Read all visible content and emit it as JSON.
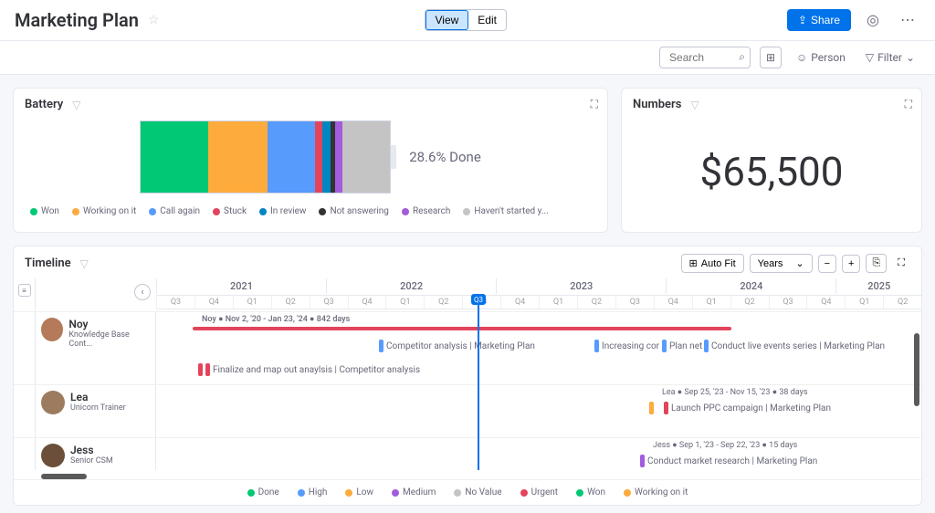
{
  "header": {
    "title": "Marketing Plan",
    "view_label": "View",
    "edit_label": "Edit",
    "share_label": "Share"
  },
  "subheader": {
    "search_placeholder": "Search",
    "person_label": "Person",
    "filter_label": "Filter"
  },
  "battery": {
    "title": "Battery",
    "pct_label": "28.6% Done",
    "legend": [
      {
        "label": "Won",
        "color": "#00c875"
      },
      {
        "label": "Working on it",
        "color": "#fdab3d"
      },
      {
        "label": "Call again",
        "color": "#579bfc"
      },
      {
        "label": "Stuck",
        "color": "#e2445c"
      },
      {
        "label": "In review",
        "color": "#0086c0"
      },
      {
        "label": "Not answering",
        "color": "#333333"
      },
      {
        "label": "Research",
        "color": "#a25ddc"
      },
      {
        "label": "Haven't started y...",
        "color": "#c4c4c4"
      }
    ]
  },
  "numbers": {
    "title": "Numbers",
    "value": "$65,500"
  },
  "timeline": {
    "title": "Timeline",
    "autofit": "Auto Fit",
    "scale": "Years",
    "years": [
      "2021",
      "2022",
      "2023",
      "2024",
      "2025"
    ],
    "quarters": [
      "Q3",
      "Q4",
      "Q1",
      "Q2",
      "Q3",
      "Q4",
      "Q1",
      "Q2",
      "Q3",
      "Q4",
      "Q1",
      "Q2",
      "Q3",
      "Q4",
      "Q1",
      "Q2",
      "Q3",
      "Q4",
      "Q1",
      "Q2"
    ],
    "now_label": "Q3",
    "people": [
      {
        "name": "Noy",
        "role": "Knowledge Base Cont...",
        "avatar_color": "#b57a5a",
        "summary": "Noy ● Nov 2, '20 - Jan 23, '24 ● 842 days",
        "tasks": [
          "Competitor analysis | Marketing Plan",
          "Increasing cor",
          "Plan net",
          "Conduct live events series | Marketing Plan",
          "Finalize and map out anaylsis | Competitor analysis"
        ]
      },
      {
        "name": "Lea",
        "role": "Unicorn Trainer",
        "avatar_color": "#9d7b5e",
        "summary": "Lea ● Sep 25, '23 - Nov 15, '23 ● 38 days",
        "tasks": [
          "Launch PPC campaign | Marketing Plan"
        ]
      },
      {
        "name": "Jess",
        "role": "Senior CSM",
        "avatar_color": "#6b4f3a",
        "summary": "Jess ● Sep 1, '23 - Sep 22, '23 ● 15 days",
        "tasks": [
          "Conduct market research | Marketing Plan"
        ]
      }
    ],
    "footer_legend": [
      {
        "label": "Done",
        "color": "#00c875"
      },
      {
        "label": "High",
        "color": "#579bfc"
      },
      {
        "label": "Low",
        "color": "#fdab3d"
      },
      {
        "label": "Medium",
        "color": "#a25ddc"
      },
      {
        "label": "No Value",
        "color": "#c4c4c4"
      },
      {
        "label": "Urgent",
        "color": "#e2445c"
      },
      {
        "label": "Won",
        "color": "#00c875"
      },
      {
        "label": "Working on it",
        "color": "#fdab3d"
      }
    ]
  },
  "chart_data": {
    "type": "bar",
    "title": "Battery",
    "categories": [
      "Won",
      "Working on it",
      "Call again",
      "Stuck",
      "In review",
      "Not answering",
      "Research",
      "Haven't started yet"
    ],
    "values": [
      27,
      24,
      19,
      3,
      3,
      2,
      3,
      19
    ],
    "colors": [
      "#00c875",
      "#fdab3d",
      "#579bfc",
      "#e2445c",
      "#0086c0",
      "#333333",
      "#a25ddc",
      "#c4c4c4"
    ],
    "annotation": "28.6% Done"
  }
}
